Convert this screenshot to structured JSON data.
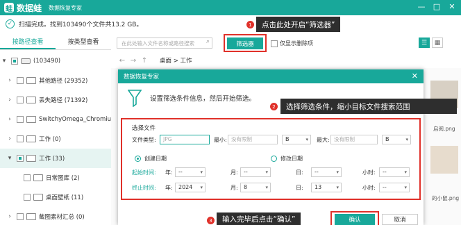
{
  "header": {
    "logo_glyph": "蛙",
    "app_name": "数据蛙",
    "app_subtitle": "数据恢复专家",
    "window_controls": [
      "—",
      "□",
      "✕"
    ]
  },
  "scan": {
    "status": "扫描完成。找到103490个文件共13.2 GB。"
  },
  "left": {
    "tabs": [
      "按路径查看",
      "按类型查看"
    ],
    "tree": [
      {
        "label": "(103490)"
      },
      {
        "label": "其他路径 (29352)"
      },
      {
        "label": "丢失路径 (71392)"
      },
      {
        "label": "SwitchyOmega_Chromium"
      },
      {
        "label": "工作 (0)"
      },
      {
        "label": "工作 (33)"
      },
      {
        "label": "日常图库 (2)"
      },
      {
        "label": "桌面壁纸 (11)"
      },
      {
        "label": "截图素材汇总 (0)"
      }
    ]
  },
  "toolbar": {
    "search_placeholder": "在此处输入文件名称或路径搜索",
    "filter_label": "筛选器",
    "show_deleted_label": "仅显示删除项"
  },
  "nav": {
    "breadcrumb": "桌面 > 工作"
  },
  "thumbs": {
    "label1": "启阅.png",
    "label2": "的小鼠.png"
  },
  "callouts": {
    "step1": "点击此处开启“筛选器”",
    "step2": "选择筛选条件，缩小目标文件搜索范围",
    "step3": "输入完毕后点击“确认”",
    "badge1": "1",
    "badge2": "2",
    "badge3": "3"
  },
  "dialog": {
    "title": "数据恢复专家",
    "intro": "设置筛选条件信息，然后开始筛选。",
    "section": "选择文件",
    "file_type_label": "文件类型:",
    "file_type_placeholder": "JPG",
    "min_label": "最小:",
    "min_placeholder": "没有限制",
    "max_label": "最大:",
    "max_placeholder": "没有限制",
    "unit_min": "B",
    "unit_max": "B",
    "created_label": "创建日期",
    "modified_label": "修改日期",
    "start_label": "起始时间:",
    "end_label": "终止时间:",
    "year_label": "年:",
    "month_label": "月:",
    "day_label": "日:",
    "hour_label": "小时:",
    "start_year": "--",
    "start_month": "--",
    "start_day": "--",
    "start_hour": "--",
    "end_year": "2024",
    "end_month": "8",
    "end_day": "13",
    "end_hour": "--",
    "ok_label": "确认",
    "cancel_label": "取消"
  }
}
